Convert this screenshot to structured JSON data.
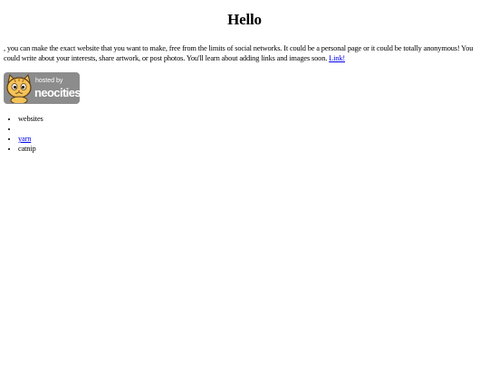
{
  "heading": "Hello",
  "intro": {
    "text": ", you can make the exact website that you want to make, free from the limits of social networks. It could be a personal page or it could be totally anonymous! You could write about your interests, share artwork, or post photos. You'll learn about adding links and images soon. ",
    "link_label": "Link!"
  },
  "badge": {
    "hosted_by": "hosted by",
    "name": "neocities",
    "icon": "neocities-cat-icon",
    "background": "#8c8c8c"
  },
  "list": {
    "items": [
      {
        "label": "websites",
        "is_link": false
      },
      {
        "label": "",
        "is_link": false
      },
      {
        "label": "yarn",
        "is_link": true
      },
      {
        "label": "catnip",
        "is_link": false
      }
    ]
  },
  "colors": {
    "link": "#0000ee",
    "text": "#000000",
    "background": "#ffffff"
  }
}
